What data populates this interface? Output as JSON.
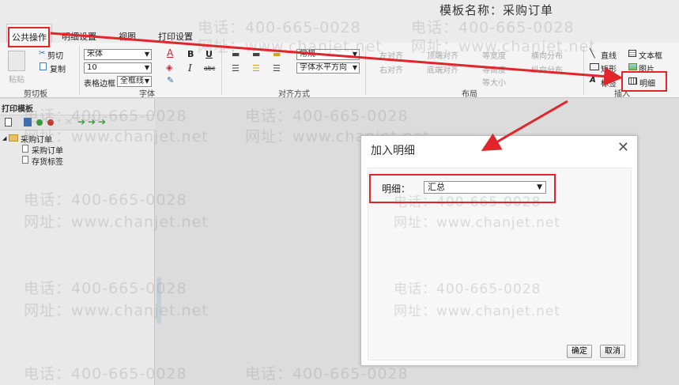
{
  "header": {
    "template_name": "模板名称：采购订单"
  },
  "tabs": [
    {
      "label": "公共操作"
    },
    {
      "label": "明细设置"
    },
    {
      "label": "视图"
    },
    {
      "label": "打印设置"
    }
  ],
  "ribbon": {
    "clipboard": {
      "paste": "粘贴",
      "cut": "剪切",
      "copy": "复制",
      "label": "剪切板"
    },
    "font": {
      "family": "宋体",
      "size": "10",
      "table_border_label": "表格边框",
      "table_border_value": "全框线",
      "bold": "B",
      "italic": "I",
      "underline": "U",
      "strike": "abc",
      "font_color": "A",
      "label": "字体"
    },
    "align": {
      "style_value": "常规",
      "horizontal_value": "字体水平方向",
      "label": "对齐方式"
    },
    "layout": {
      "left_align": "左对齐",
      "right_align": "右对齐",
      "top_align": "顶端对齐",
      "bottom_align": "底端对齐",
      "same_width": "等宽度",
      "same_height": "等高度",
      "same_size": "等大小",
      "h_distribute": "横向分布",
      "v_distribute": "纵向分布",
      "label": "布局"
    },
    "insert": {
      "line": "直线",
      "rect": "矩形",
      "tag": "标签",
      "textbox": "文本框",
      "image": "图片",
      "detail": "明细",
      "label": "插入"
    }
  },
  "left_panel": {
    "title": "打印模板",
    "tree": {
      "root": "采购订单",
      "children": [
        "采购订单",
        "存货标签"
      ]
    }
  },
  "dialog": {
    "title": "加入明细",
    "close": "✕",
    "field_label": "明细：",
    "field_value": "汇总",
    "ok": "确定",
    "cancel": "取消"
  },
  "watermark": {
    "phone": "电话：400-665-0028",
    "site": "网址：www.chanjet.net"
  },
  "colors": {
    "highlight": "#e0262b",
    "ribbon_bg": "#f4f4f4",
    "canvas_bg": "#dcdcdc"
  }
}
